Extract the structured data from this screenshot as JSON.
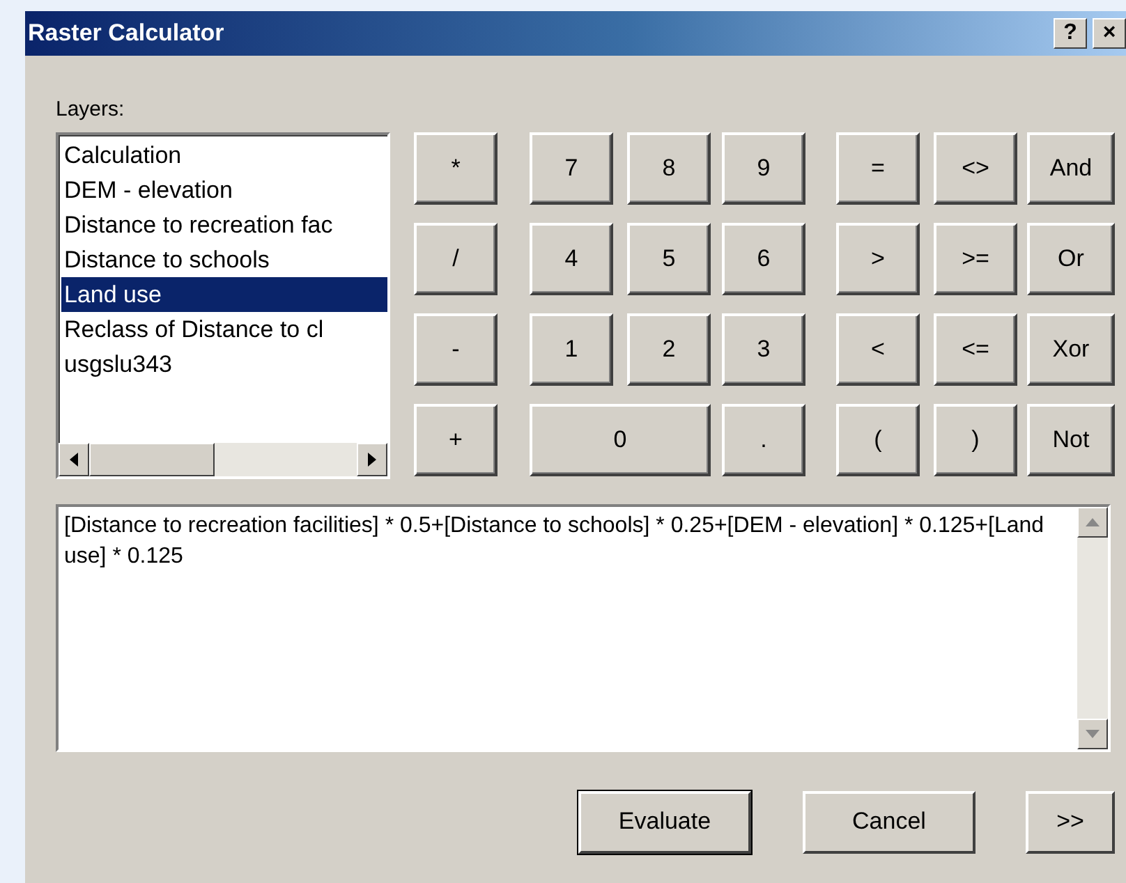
{
  "window": {
    "title": "Raster Calculator",
    "help_button": "?",
    "close_button": "×"
  },
  "layers": {
    "label": "Layers:",
    "items": [
      {
        "text": "Calculation",
        "selected": false
      },
      {
        "text": "DEM - elevation",
        "selected": false
      },
      {
        "text": "Distance to recreation fac",
        "selected": false
      },
      {
        "text": "Distance to schools",
        "selected": false
      },
      {
        "text": "Land use",
        "selected": true
      },
      {
        "text": "Reclass of Distance to cl",
        "selected": false
      },
      {
        "text": "usgslu343",
        "selected": false
      }
    ]
  },
  "keypad": [
    [
      {
        "label": "*",
        "kind": "key"
      },
      {
        "label": "7",
        "kind": "key"
      },
      {
        "label": "8",
        "kind": "key"
      },
      {
        "label": "9",
        "kind": "key"
      },
      {
        "label": "=",
        "kind": "key"
      },
      {
        "label": "<>",
        "kind": "key"
      },
      {
        "label": "And",
        "kind": "key"
      }
    ],
    [
      {
        "label": "/",
        "kind": "key"
      },
      {
        "label": "4",
        "kind": "key"
      },
      {
        "label": "5",
        "kind": "key"
      },
      {
        "label": "6",
        "kind": "key"
      },
      {
        "label": ">",
        "kind": "key"
      },
      {
        "label": ">=",
        "kind": "key"
      },
      {
        "label": "Or",
        "kind": "key"
      }
    ],
    [
      {
        "label": "-",
        "kind": "key"
      },
      {
        "label": "1",
        "kind": "key"
      },
      {
        "label": "2",
        "kind": "key"
      },
      {
        "label": "3",
        "kind": "key"
      },
      {
        "label": "<",
        "kind": "key"
      },
      {
        "label": "<=",
        "kind": "key"
      },
      {
        "label": "Xor",
        "kind": "key"
      }
    ],
    [
      {
        "label": "+",
        "kind": "key"
      },
      {
        "label": "0",
        "kind": "wide"
      },
      {
        "label": ".",
        "kind": "key"
      },
      {
        "label": "(",
        "kind": "key"
      },
      {
        "label": ")",
        "kind": "key"
      },
      {
        "label": "Not",
        "kind": "key"
      }
    ]
  ],
  "expression": "[Distance to recreation facilities] * 0.5+[Distance to schools] * 0.25+[DEM - elevation] * 0.125+[Land use] * 0.125",
  "buttons": [
    {
      "label": "Evaluate",
      "default": true
    },
    {
      "label": "Cancel",
      "default": false
    },
    {
      "label": ">>",
      "default": false
    }
  ]
}
